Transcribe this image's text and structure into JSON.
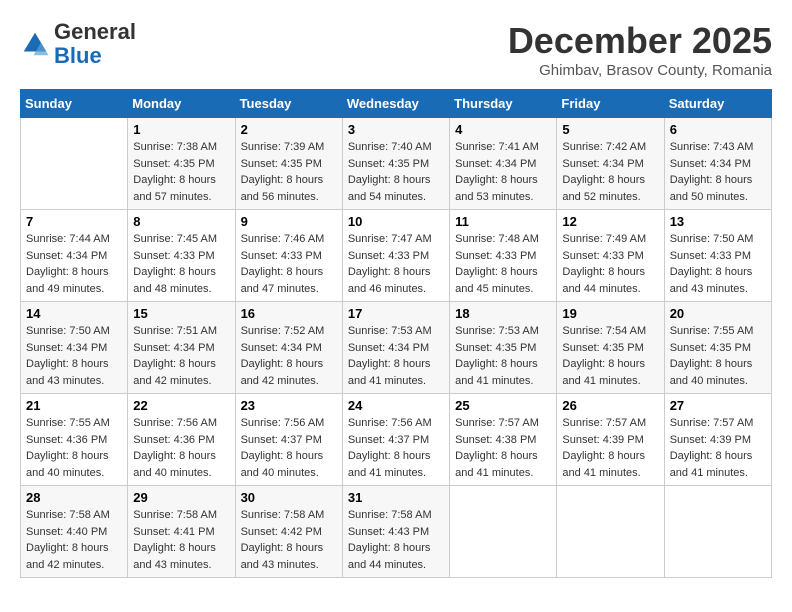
{
  "logo": {
    "general": "General",
    "blue": "Blue"
  },
  "title": "December 2025",
  "subtitle": "Ghimbav, Brasov County, Romania",
  "weekdays": [
    "Sunday",
    "Monday",
    "Tuesday",
    "Wednesday",
    "Thursday",
    "Friday",
    "Saturday"
  ],
  "weeks": [
    [
      {
        "day": "",
        "sunrise": "",
        "sunset": "",
        "daylight": ""
      },
      {
        "day": "1",
        "sunrise": "Sunrise: 7:38 AM",
        "sunset": "Sunset: 4:35 PM",
        "daylight": "Daylight: 8 hours and 57 minutes."
      },
      {
        "day": "2",
        "sunrise": "Sunrise: 7:39 AM",
        "sunset": "Sunset: 4:35 PM",
        "daylight": "Daylight: 8 hours and 56 minutes."
      },
      {
        "day": "3",
        "sunrise": "Sunrise: 7:40 AM",
        "sunset": "Sunset: 4:35 PM",
        "daylight": "Daylight: 8 hours and 54 minutes."
      },
      {
        "day": "4",
        "sunrise": "Sunrise: 7:41 AM",
        "sunset": "Sunset: 4:34 PM",
        "daylight": "Daylight: 8 hours and 53 minutes."
      },
      {
        "day": "5",
        "sunrise": "Sunrise: 7:42 AM",
        "sunset": "Sunset: 4:34 PM",
        "daylight": "Daylight: 8 hours and 52 minutes."
      },
      {
        "day": "6",
        "sunrise": "Sunrise: 7:43 AM",
        "sunset": "Sunset: 4:34 PM",
        "daylight": "Daylight: 8 hours and 50 minutes."
      }
    ],
    [
      {
        "day": "7",
        "sunrise": "Sunrise: 7:44 AM",
        "sunset": "Sunset: 4:34 PM",
        "daylight": "Daylight: 8 hours and 49 minutes."
      },
      {
        "day": "8",
        "sunrise": "Sunrise: 7:45 AM",
        "sunset": "Sunset: 4:33 PM",
        "daylight": "Daylight: 8 hours and 48 minutes."
      },
      {
        "day": "9",
        "sunrise": "Sunrise: 7:46 AM",
        "sunset": "Sunset: 4:33 PM",
        "daylight": "Daylight: 8 hours and 47 minutes."
      },
      {
        "day": "10",
        "sunrise": "Sunrise: 7:47 AM",
        "sunset": "Sunset: 4:33 PM",
        "daylight": "Daylight: 8 hours and 46 minutes."
      },
      {
        "day": "11",
        "sunrise": "Sunrise: 7:48 AM",
        "sunset": "Sunset: 4:33 PM",
        "daylight": "Daylight: 8 hours and 45 minutes."
      },
      {
        "day": "12",
        "sunrise": "Sunrise: 7:49 AM",
        "sunset": "Sunset: 4:33 PM",
        "daylight": "Daylight: 8 hours and 44 minutes."
      },
      {
        "day": "13",
        "sunrise": "Sunrise: 7:50 AM",
        "sunset": "Sunset: 4:33 PM",
        "daylight": "Daylight: 8 hours and 43 minutes."
      }
    ],
    [
      {
        "day": "14",
        "sunrise": "Sunrise: 7:50 AM",
        "sunset": "Sunset: 4:34 PM",
        "daylight": "Daylight: 8 hours and 43 minutes."
      },
      {
        "day": "15",
        "sunrise": "Sunrise: 7:51 AM",
        "sunset": "Sunset: 4:34 PM",
        "daylight": "Daylight: 8 hours and 42 minutes."
      },
      {
        "day": "16",
        "sunrise": "Sunrise: 7:52 AM",
        "sunset": "Sunset: 4:34 PM",
        "daylight": "Daylight: 8 hours and 42 minutes."
      },
      {
        "day": "17",
        "sunrise": "Sunrise: 7:53 AM",
        "sunset": "Sunset: 4:34 PM",
        "daylight": "Daylight: 8 hours and 41 minutes."
      },
      {
        "day": "18",
        "sunrise": "Sunrise: 7:53 AM",
        "sunset": "Sunset: 4:35 PM",
        "daylight": "Daylight: 8 hours and 41 minutes."
      },
      {
        "day": "19",
        "sunrise": "Sunrise: 7:54 AM",
        "sunset": "Sunset: 4:35 PM",
        "daylight": "Daylight: 8 hours and 41 minutes."
      },
      {
        "day": "20",
        "sunrise": "Sunrise: 7:55 AM",
        "sunset": "Sunset: 4:35 PM",
        "daylight": "Daylight: 8 hours and 40 minutes."
      }
    ],
    [
      {
        "day": "21",
        "sunrise": "Sunrise: 7:55 AM",
        "sunset": "Sunset: 4:36 PM",
        "daylight": "Daylight: 8 hours and 40 minutes."
      },
      {
        "day": "22",
        "sunrise": "Sunrise: 7:56 AM",
        "sunset": "Sunset: 4:36 PM",
        "daylight": "Daylight: 8 hours and 40 minutes."
      },
      {
        "day": "23",
        "sunrise": "Sunrise: 7:56 AM",
        "sunset": "Sunset: 4:37 PM",
        "daylight": "Daylight: 8 hours and 40 minutes."
      },
      {
        "day": "24",
        "sunrise": "Sunrise: 7:56 AM",
        "sunset": "Sunset: 4:37 PM",
        "daylight": "Daylight: 8 hours and 41 minutes."
      },
      {
        "day": "25",
        "sunrise": "Sunrise: 7:57 AM",
        "sunset": "Sunset: 4:38 PM",
        "daylight": "Daylight: 8 hours and 41 minutes."
      },
      {
        "day": "26",
        "sunrise": "Sunrise: 7:57 AM",
        "sunset": "Sunset: 4:39 PM",
        "daylight": "Daylight: 8 hours and 41 minutes."
      },
      {
        "day": "27",
        "sunrise": "Sunrise: 7:57 AM",
        "sunset": "Sunset: 4:39 PM",
        "daylight": "Daylight: 8 hours and 41 minutes."
      }
    ],
    [
      {
        "day": "28",
        "sunrise": "Sunrise: 7:58 AM",
        "sunset": "Sunset: 4:40 PM",
        "daylight": "Daylight: 8 hours and 42 minutes."
      },
      {
        "day": "29",
        "sunrise": "Sunrise: 7:58 AM",
        "sunset": "Sunset: 4:41 PM",
        "daylight": "Daylight: 8 hours and 43 minutes."
      },
      {
        "day": "30",
        "sunrise": "Sunrise: 7:58 AM",
        "sunset": "Sunset: 4:42 PM",
        "daylight": "Daylight: 8 hours and 43 minutes."
      },
      {
        "day": "31",
        "sunrise": "Sunrise: 7:58 AM",
        "sunset": "Sunset: 4:43 PM",
        "daylight": "Daylight: 8 hours and 44 minutes."
      },
      {
        "day": "",
        "sunrise": "",
        "sunset": "",
        "daylight": ""
      },
      {
        "day": "",
        "sunrise": "",
        "sunset": "",
        "daylight": ""
      },
      {
        "day": "",
        "sunrise": "",
        "sunset": "",
        "daylight": ""
      }
    ]
  ]
}
